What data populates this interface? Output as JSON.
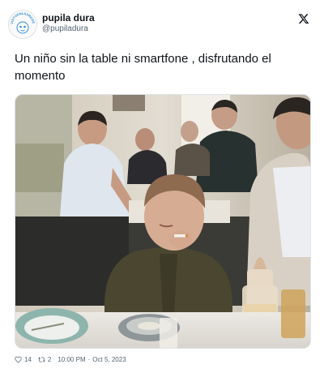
{
  "author": {
    "name": "pupila dura",
    "handle": "@pupiladura",
    "avatar_badge_text": "VISTOENLASREDES"
  },
  "tweet": {
    "text": "Un niño sin la table ni smartfone , disfrutando el momento"
  },
  "footer": {
    "likes": "14",
    "retweets": "2",
    "time": "10:00 PM",
    "date": "Oct 5, 2023"
  },
  "icons": {
    "like": "heart-icon",
    "retweet": "retweet-icon",
    "platform": "x-logo-icon"
  },
  "colors": {
    "text": "#0f1419",
    "secondary": "#536471"
  }
}
